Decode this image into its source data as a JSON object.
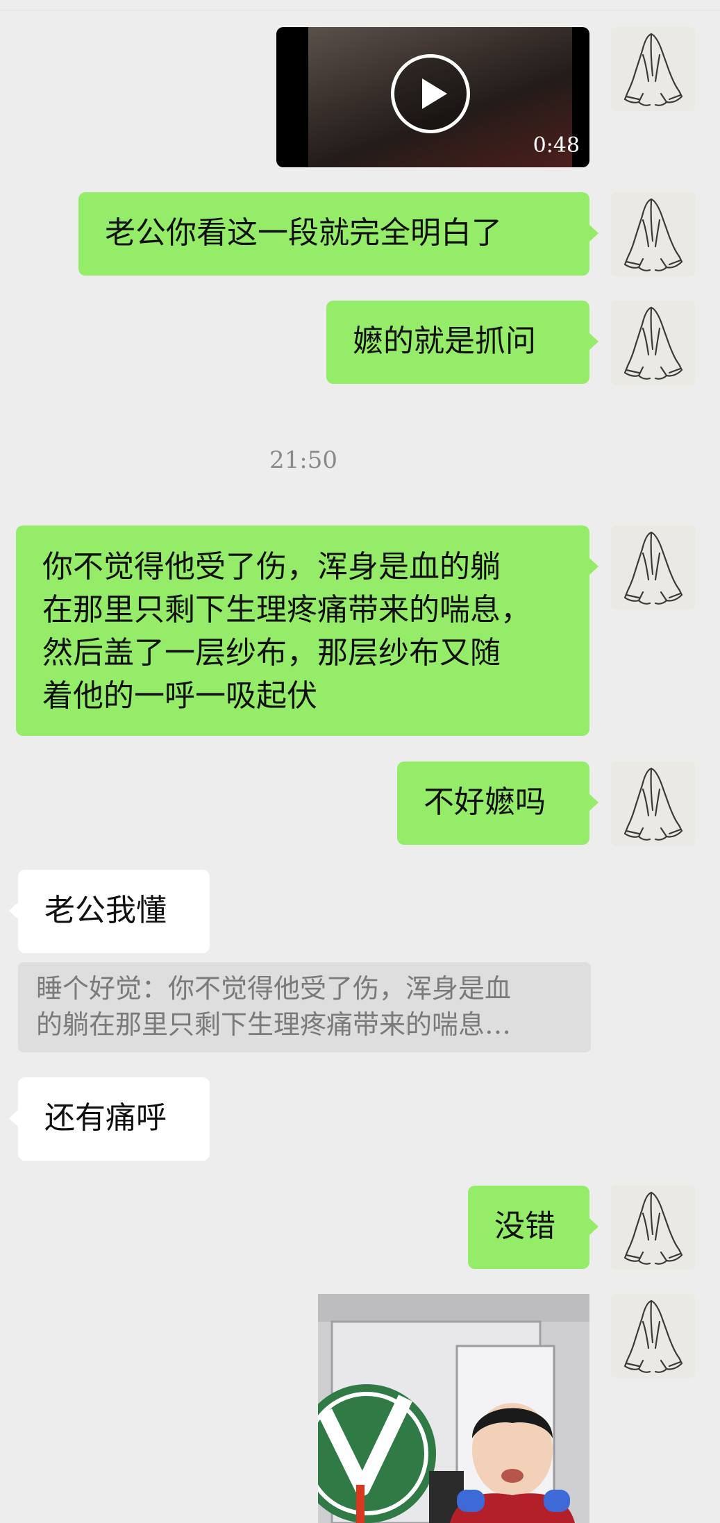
{
  "messages": [
    {
      "type": "video",
      "sender": "me",
      "duration": "0:48"
    },
    {
      "type": "text",
      "sender": "me",
      "text": "老公你看这一段就完全明白了"
    },
    {
      "type": "text",
      "sender": "me",
      "text": "嬷的就是抓问"
    },
    {
      "type": "time",
      "text": "21:50"
    },
    {
      "type": "text",
      "sender": "me",
      "lines": [
        "你不觉得他受了伤，浑身是血的躺",
        "在那里只剩下生理疼痛带来的喘息，",
        "然后盖了一层纱布，那层纱布又随",
        "着他的一呼一吸起伏"
      ]
    },
    {
      "type": "text",
      "sender": "me",
      "text": "不好嬷吗"
    },
    {
      "type": "text",
      "sender": "them",
      "text": "老公我懂"
    },
    {
      "type": "quote",
      "lines": [
        "睡个好觉：你不觉得他受了伤，浑身是血",
        "的躺在那里只剩下生理疼痛带来的喘息…"
      ]
    },
    {
      "type": "text",
      "sender": "them",
      "text": "还有痛呼"
    },
    {
      "type": "text",
      "sender": "me",
      "text": "没错"
    },
    {
      "type": "image",
      "sender": "me"
    }
  ],
  "icons": {
    "avatar": "praying-hands-sketch-icon",
    "video_play": "play-icon"
  },
  "colors": {
    "background": "#ededed",
    "my_bubble": "#95ec69",
    "their_bubble": "#ffffff",
    "quote_background": "#dedede"
  }
}
